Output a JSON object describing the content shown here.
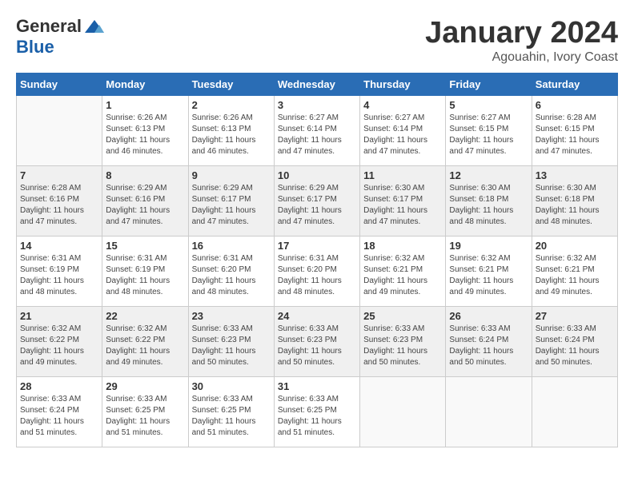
{
  "logo": {
    "general": "General",
    "blue": "Blue"
  },
  "title": "January 2024",
  "location": "Agouahin, Ivory Coast",
  "days_of_week": [
    "Sunday",
    "Monday",
    "Tuesday",
    "Wednesday",
    "Thursday",
    "Friday",
    "Saturday"
  ],
  "weeks": [
    [
      {
        "day": "",
        "info": ""
      },
      {
        "day": "1",
        "info": "Sunrise: 6:26 AM\nSunset: 6:13 PM\nDaylight: 11 hours\nand 46 minutes."
      },
      {
        "day": "2",
        "info": "Sunrise: 6:26 AM\nSunset: 6:13 PM\nDaylight: 11 hours\nand 46 minutes."
      },
      {
        "day": "3",
        "info": "Sunrise: 6:27 AM\nSunset: 6:14 PM\nDaylight: 11 hours\nand 47 minutes."
      },
      {
        "day": "4",
        "info": "Sunrise: 6:27 AM\nSunset: 6:14 PM\nDaylight: 11 hours\nand 47 minutes."
      },
      {
        "day": "5",
        "info": "Sunrise: 6:27 AM\nSunset: 6:15 PM\nDaylight: 11 hours\nand 47 minutes."
      },
      {
        "day": "6",
        "info": "Sunrise: 6:28 AM\nSunset: 6:15 PM\nDaylight: 11 hours\nand 47 minutes."
      }
    ],
    [
      {
        "day": "7",
        "info": "Sunrise: 6:28 AM\nSunset: 6:16 PM\nDaylight: 11 hours\nand 47 minutes."
      },
      {
        "day": "8",
        "info": "Sunrise: 6:29 AM\nSunset: 6:16 PM\nDaylight: 11 hours\nand 47 minutes."
      },
      {
        "day": "9",
        "info": "Sunrise: 6:29 AM\nSunset: 6:17 PM\nDaylight: 11 hours\nand 47 minutes."
      },
      {
        "day": "10",
        "info": "Sunrise: 6:29 AM\nSunset: 6:17 PM\nDaylight: 11 hours\nand 47 minutes."
      },
      {
        "day": "11",
        "info": "Sunrise: 6:30 AM\nSunset: 6:17 PM\nDaylight: 11 hours\nand 47 minutes."
      },
      {
        "day": "12",
        "info": "Sunrise: 6:30 AM\nSunset: 6:18 PM\nDaylight: 11 hours\nand 48 minutes."
      },
      {
        "day": "13",
        "info": "Sunrise: 6:30 AM\nSunset: 6:18 PM\nDaylight: 11 hours\nand 48 minutes."
      }
    ],
    [
      {
        "day": "14",
        "info": "Sunrise: 6:31 AM\nSunset: 6:19 PM\nDaylight: 11 hours\nand 48 minutes."
      },
      {
        "day": "15",
        "info": "Sunrise: 6:31 AM\nSunset: 6:19 PM\nDaylight: 11 hours\nand 48 minutes."
      },
      {
        "day": "16",
        "info": "Sunrise: 6:31 AM\nSunset: 6:20 PM\nDaylight: 11 hours\nand 48 minutes."
      },
      {
        "day": "17",
        "info": "Sunrise: 6:31 AM\nSunset: 6:20 PM\nDaylight: 11 hours\nand 48 minutes."
      },
      {
        "day": "18",
        "info": "Sunrise: 6:32 AM\nSunset: 6:21 PM\nDaylight: 11 hours\nand 49 minutes."
      },
      {
        "day": "19",
        "info": "Sunrise: 6:32 AM\nSunset: 6:21 PM\nDaylight: 11 hours\nand 49 minutes."
      },
      {
        "day": "20",
        "info": "Sunrise: 6:32 AM\nSunset: 6:21 PM\nDaylight: 11 hours\nand 49 minutes."
      }
    ],
    [
      {
        "day": "21",
        "info": "Sunrise: 6:32 AM\nSunset: 6:22 PM\nDaylight: 11 hours\nand 49 minutes."
      },
      {
        "day": "22",
        "info": "Sunrise: 6:32 AM\nSunset: 6:22 PM\nDaylight: 11 hours\nand 49 minutes."
      },
      {
        "day": "23",
        "info": "Sunrise: 6:33 AM\nSunset: 6:23 PM\nDaylight: 11 hours\nand 50 minutes."
      },
      {
        "day": "24",
        "info": "Sunrise: 6:33 AM\nSunset: 6:23 PM\nDaylight: 11 hours\nand 50 minutes."
      },
      {
        "day": "25",
        "info": "Sunrise: 6:33 AM\nSunset: 6:23 PM\nDaylight: 11 hours\nand 50 minutes."
      },
      {
        "day": "26",
        "info": "Sunrise: 6:33 AM\nSunset: 6:24 PM\nDaylight: 11 hours\nand 50 minutes."
      },
      {
        "day": "27",
        "info": "Sunrise: 6:33 AM\nSunset: 6:24 PM\nDaylight: 11 hours\nand 50 minutes."
      }
    ],
    [
      {
        "day": "28",
        "info": "Sunrise: 6:33 AM\nSunset: 6:24 PM\nDaylight: 11 hours\nand 51 minutes."
      },
      {
        "day": "29",
        "info": "Sunrise: 6:33 AM\nSunset: 6:25 PM\nDaylight: 11 hours\nand 51 minutes."
      },
      {
        "day": "30",
        "info": "Sunrise: 6:33 AM\nSunset: 6:25 PM\nDaylight: 11 hours\nand 51 minutes."
      },
      {
        "day": "31",
        "info": "Sunrise: 6:33 AM\nSunset: 6:25 PM\nDaylight: 11 hours\nand 51 minutes."
      },
      {
        "day": "",
        "info": ""
      },
      {
        "day": "",
        "info": ""
      },
      {
        "day": "",
        "info": ""
      }
    ]
  ]
}
